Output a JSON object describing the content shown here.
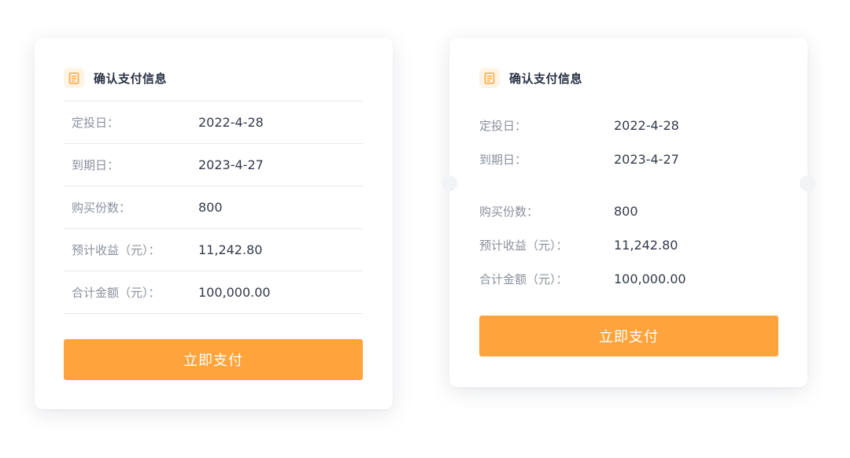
{
  "accent_color": "#ffa43c",
  "cards": [
    {
      "header": {
        "icon": "document-icon",
        "title": "确认支付信息"
      },
      "rows": [
        {
          "label": "定投日：",
          "value": "2022-4-28"
        },
        {
          "label": "到期日：",
          "value": "2023-4-27"
        },
        {
          "label": "购买份数：",
          "value": "800"
        },
        {
          "label": "预计收益（元）：",
          "value": "11,242.80"
        },
        {
          "label": "合计金额（元）：",
          "value": "100,000.00"
        }
      ],
      "button_label": "立即支付"
    },
    {
      "header": {
        "icon": "document-icon",
        "title": "确认支付信息"
      },
      "rows": [
        {
          "label": "定投日：",
          "value": "2022-4-28"
        },
        {
          "label": "到期日：",
          "value": "2023-4-27"
        },
        {
          "label": "购买份数：",
          "value": "800"
        },
        {
          "label": "预计收益（元）：",
          "value": "11,242.80"
        },
        {
          "label": "合计金额（元）：",
          "value": "100,000.00"
        }
      ],
      "button_label": "立即支付"
    }
  ]
}
